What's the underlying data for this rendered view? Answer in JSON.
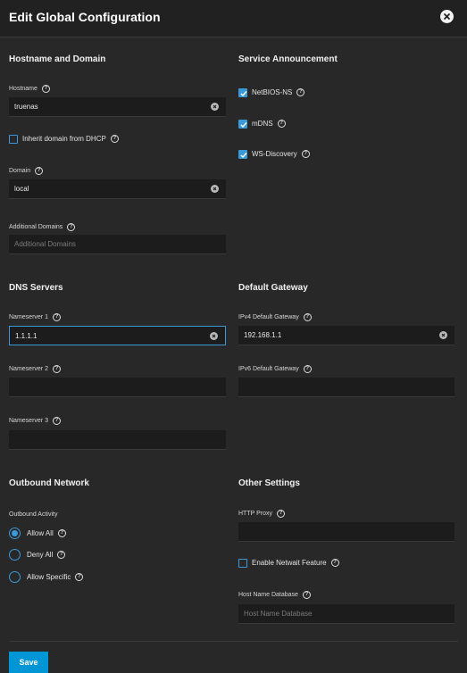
{
  "dialog": {
    "title": "Edit Global Configuration",
    "close_icon": "close-icon"
  },
  "hostname_domain": {
    "title": "Hostname and Domain",
    "hostname": {
      "label": "Hostname",
      "value": "truenas"
    },
    "inherit_dhcp": {
      "label": "Inherit domain from DHCP",
      "checked": false
    },
    "domain": {
      "label": "Domain",
      "value": "local"
    },
    "additional_domains": {
      "label": "Additional Domains",
      "placeholder": "Additional Domains"
    }
  },
  "service_announcement": {
    "title": "Service Announcement",
    "items": [
      {
        "label": "NetBIOS-NS",
        "checked": true
      },
      {
        "label": "mDNS",
        "checked": true
      },
      {
        "label": "WS-Discovery",
        "checked": true
      }
    ]
  },
  "dns_servers": {
    "title": "DNS Servers",
    "nameserver1": {
      "label": "Nameserver 1",
      "value": "1.1.1.1"
    },
    "nameserver2": {
      "label": "Nameserver 2",
      "value": ""
    },
    "nameserver3": {
      "label": "Nameserver 3",
      "value": ""
    }
  },
  "default_gateway": {
    "title": "Default Gateway",
    "ipv4": {
      "label": "IPv4 Default Gateway",
      "value": "192.168.1.1"
    },
    "ipv6": {
      "label": "IPv6 Default Gateway",
      "value": ""
    }
  },
  "outbound_network": {
    "title": "Outbound Network",
    "activity_label": "Outbound Activity",
    "options": [
      {
        "label": "Allow All",
        "selected": true
      },
      {
        "label": "Deny All",
        "selected": false
      },
      {
        "label": "Allow Specific",
        "selected": false
      }
    ]
  },
  "other_settings": {
    "title": "Other Settings",
    "http_proxy": {
      "label": "HTTP Proxy",
      "value": ""
    },
    "netwait": {
      "label": "Enable Netwait Feature",
      "checked": false
    },
    "host_name_database": {
      "label": "Host Name Database",
      "placeholder": "Host Name Database"
    }
  },
  "footer": {
    "save_label": "Save"
  },
  "colors": {
    "accent": "#0095d5",
    "background": "#282828",
    "header": "#212121",
    "input": "#1c1c1c"
  }
}
